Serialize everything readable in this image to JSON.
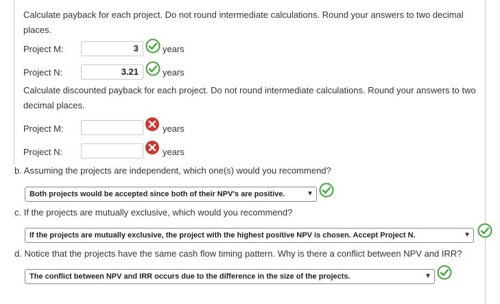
{
  "part_a": {
    "instruction": "Calculate payback for each project. Do not round intermediate calculations. Round your answers to two decimal places.",
    "rows": [
      {
        "label": "Project M:",
        "value": "3",
        "unit": "years",
        "status": "correct"
      },
      {
        "label": "Project N:",
        "value": "3.21",
        "unit": "years",
        "status": "correct"
      }
    ],
    "instruction2": "Calculate discounted payback for each project. Do not round intermediate calculations. Round your answers to two decimal places.",
    "rows2": [
      {
        "label": "Project M:",
        "value": "",
        "unit": "years",
        "status": "incorrect"
      },
      {
        "label": "Project N:",
        "value": "",
        "unit": "years",
        "status": "incorrect"
      }
    ]
  },
  "part_b": {
    "question": "b. Assuming the projects are independent, which one(s) would you recommend?",
    "selected": "Both projects would be accepted since both of their NPV's are positive.",
    "status": "correct"
  },
  "part_c": {
    "question": "c. If the projects are mutually exclusive, which would you recommend?",
    "selected": "If the projects are mutually exclusive, the project with the highest positive NPV is chosen. Accept Project N.",
    "status": "correct"
  },
  "part_d": {
    "question": "d. Notice that the projects have the same cash flow timing pattern. Why is there a conflict between NPV and IRR?",
    "selected": "The conflict between NPV and IRR occurs due to the difference in the size of the projects.",
    "status": "correct"
  },
  "colors": {
    "correct": "#3aa832",
    "incorrect": "#d0342c"
  },
  "icons": {
    "correct": "check-circle-icon",
    "incorrect": "x-circle-icon",
    "dropdown": "chevron-down-icon"
  }
}
